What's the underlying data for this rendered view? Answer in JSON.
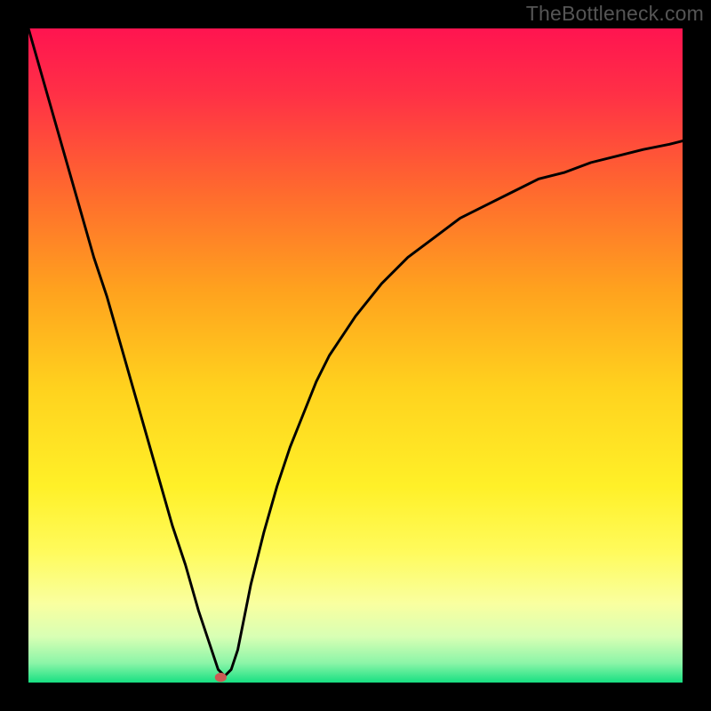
{
  "watermark": "TheBottleneck.com",
  "chart_data": {
    "type": "line",
    "title": "",
    "xlabel": "",
    "ylabel": "",
    "xrange": [
      0,
      100
    ],
    "yrange": [
      0,
      100
    ],
    "curve": {
      "name": "bottleneck-curve",
      "x": [
        0,
        2,
        4,
        6,
        8,
        10,
        12,
        14,
        16,
        18,
        20,
        22,
        24,
        26,
        28,
        29,
        30,
        31,
        32,
        33,
        34,
        36,
        38,
        40,
        42,
        44,
        46,
        48,
        50,
        54,
        58,
        62,
        66,
        70,
        74,
        78,
        82,
        86,
        90,
        94,
        98,
        100
      ],
      "y": [
        100,
        93,
        86,
        79,
        72,
        65,
        59,
        52,
        45,
        38,
        31,
        24,
        18,
        11,
        5,
        2,
        1,
        2,
        5,
        10,
        15,
        23,
        30,
        36,
        41,
        46,
        50,
        53,
        56,
        61,
        65,
        68,
        71,
        73,
        75,
        77,
        78,
        79.5,
        80.5,
        81.5,
        82.3,
        82.8
      ]
    },
    "marker": {
      "x": 29.4,
      "y": 0.8,
      "color": "#cc5a54"
    },
    "gradient_stops": [
      {
        "offset": 0.0,
        "color": "#ff1450"
      },
      {
        "offset": 0.1,
        "color": "#ff3046"
      },
      {
        "offset": 0.25,
        "color": "#ff6a2e"
      },
      {
        "offset": 0.4,
        "color": "#ffa21e"
      },
      {
        "offset": 0.55,
        "color": "#ffd21e"
      },
      {
        "offset": 0.7,
        "color": "#fff028"
      },
      {
        "offset": 0.8,
        "color": "#fffb5c"
      },
      {
        "offset": 0.88,
        "color": "#f9ffa0"
      },
      {
        "offset": 0.93,
        "color": "#d8ffb4"
      },
      {
        "offset": 0.97,
        "color": "#8cf5a8"
      },
      {
        "offset": 1.0,
        "color": "#18e082"
      }
    ]
  }
}
